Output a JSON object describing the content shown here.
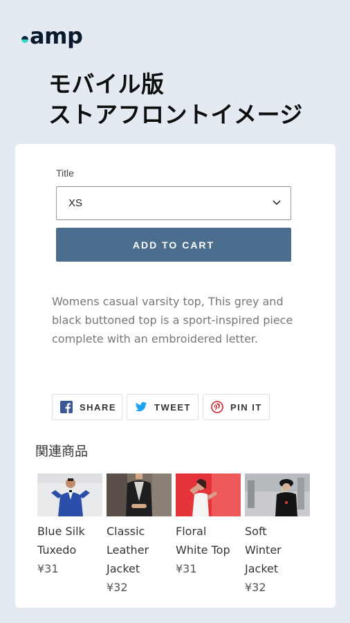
{
  "brand": {
    "logo_text": "amp"
  },
  "headline": {
    "line1": "モバイル版",
    "line2": "ストアフロントイメージ"
  },
  "product_form": {
    "option_label": "Title",
    "option_value": "XS",
    "add_to_cart_label": "ADD TO CART"
  },
  "description": "Womens casual varsity top, This grey and black buttoned top is a sport-inspired piece complete with an embroidered letter.",
  "share": [
    {
      "label": "SHARE",
      "icon": "facebook-icon",
      "color": "#3b5998"
    },
    {
      "label": "TWEET",
      "icon": "twitter-icon",
      "color": "#1da1f2"
    },
    {
      "label": "PIN IT",
      "icon": "pinterest-icon",
      "color": "#cb2027"
    }
  ],
  "related": {
    "title": "関連商品",
    "products": [
      {
        "name_lines": [
          "Blue Silk",
          "Tuxedo"
        ],
        "price": "¥31"
      },
      {
        "name_lines": [
          "Classic",
          "Leather",
          "Jacket"
        ],
        "price": "¥32"
      },
      {
        "name_lines": [
          "Floral",
          "White Top"
        ],
        "price": "¥31"
      },
      {
        "name_lines": [
          "Soft",
          "Winter",
          "Jacket"
        ],
        "price": "¥32"
      }
    ]
  },
  "colors": {
    "background": "#e3eaf2",
    "button": "#4c6e8e",
    "logo_accent": "#2fd6c0"
  }
}
